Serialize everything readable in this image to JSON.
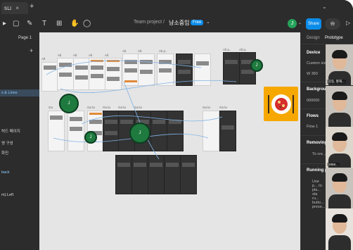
{
  "tabs": [
    {
      "label": "s⊔"
    },
    {
      "label": "+"
    }
  ],
  "toolbar": {
    "breadcrumb": "Team project",
    "separator": "/",
    "file_name": "냠소중임",
    "plan_badge": "Free",
    "avatar_letter": "J",
    "share_label": "Share"
  },
  "left_panel": {
    "page_selector": "Page 1",
    "items": [
      {
        "label": "s & Lines"
      },
      {
        "label": "허드 페이지"
      },
      {
        "label": "영 구성"
      },
      {
        "label": "화진"
      },
      {
        "label": "back"
      },
      {
        "label": "m).Left"
      }
    ]
  },
  "canvas": {
    "frame_label": "Ga",
    "frame_labels_top": [
      "Alt",
      "Alt",
      "Alt",
      "Alt",
      "Alt",
      "Alt",
      "Alt",
      "Alt p..",
      "Alt p..",
      "Alt p.."
    ],
    "frame_labels_mid": [
      "Ga",
      "Ga",
      "Ga la",
      "Ga la",
      "Ga la",
      "Ga la",
      "Ga la",
      "Ga la"
    ],
    "cursors": [
      {
        "letter": "J"
      },
      {
        "letter": "J"
      },
      {
        "letter": "J"
      },
      {
        "letter": "J"
      }
    ]
  },
  "right_panel": {
    "tab_design": "Design",
    "tab_prototype": "Prototype",
    "sections": [
      {
        "heading": "Device",
        "text": "Custom size"
      },
      {
        "heading": "",
        "text": "W  360"
      },
      {
        "heading": "Background",
        "text": "000000"
      },
      {
        "heading": "Flows",
        "text": "Flow 1"
      },
      {
        "heading": "Removing a",
        "text": "To cre..."
      },
      {
        "heading": "Running pr",
        "text": "Use p... to pla... sta ru... butto... prese..."
      }
    ]
  },
  "video_participants": [
    {
      "name": "강동, 황재..."
    },
    {
      "name": ""
    },
    {
      "name": "1958..."
    },
    {
      "name": ""
    },
    {
      "name": ""
    }
  ],
  "colors": {
    "accent": "#0c8ce9",
    "cursor": "#1f7a3f",
    "plate_bg": "#f6a800"
  }
}
